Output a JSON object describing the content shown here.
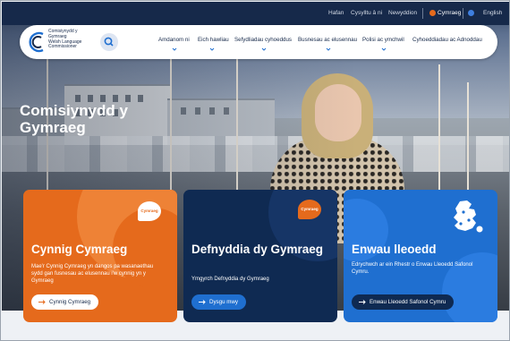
{
  "utility_bar": {
    "links": [
      "Hafan",
      "Cysylltu â ni",
      "Newyddion"
    ],
    "languages": [
      {
        "label": "Cymraeg",
        "selected": true,
        "dot_color": "#e56a1c"
      },
      {
        "label": "English",
        "selected": false,
        "dot_color": "#3f7fe0"
      }
    ]
  },
  "logo": {
    "lines": [
      "Comisiynydd y",
      "Gymraeg",
      "Welsh Language",
      "Commissioner"
    ],
    "icon": "commissioner-logo-icon"
  },
  "search": {
    "icon": "search-icon"
  },
  "nav": {
    "items": [
      {
        "label": "Amdanom ni",
        "has_dropdown": true
      },
      {
        "label": "Eich hawliau",
        "has_dropdown": true
      },
      {
        "label": "Sefydliadau cyhoeddus",
        "has_dropdown": true
      },
      {
        "label": "Busnesau ac elusennau",
        "has_dropdown": true
      },
      {
        "label": "Polisi ac ymchwil",
        "has_dropdown": true
      },
      {
        "label": "Cyhoeddiadau ac Adnoddau",
        "has_dropdown": false
      }
    ]
  },
  "hero": {
    "title": "Comisiynydd y Gymraeg"
  },
  "cards": [
    {
      "title": "Cynnig Cymraeg",
      "description": "Mae'r Cynnig Cymraeg yn dangos pa wasanaethau sydd gan fusnesau ac elusennau i'w cynnig yn y Gymraeg",
      "button": "Cynnig Cymraeg",
      "badge": "Cymraeg",
      "color": "#e56a1c"
    },
    {
      "title": "Defnyddia dy Gymraeg",
      "description": "Ymgyrch Defnyddia dy Gymraeg",
      "button": "Dysgu mwy",
      "badge": "Cymraeg",
      "color": "#0f2a52"
    },
    {
      "title": "Enwau lleoedd",
      "description": "Edrychwch ar ein Rhestr o Enwau Lleoedd Safonol Cymru.",
      "button": "Enwau Lleoedd Safonol Cymru",
      "icon": "wales-map-icon",
      "color": "#1f6fd0"
    }
  ]
}
